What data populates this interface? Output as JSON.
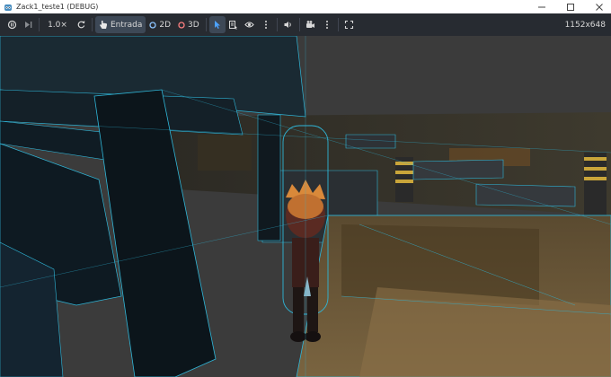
{
  "window": {
    "title": "Zack1_teste1 (DEBUG)",
    "resolution": "1152x648"
  },
  "toolbar": {
    "speed": "1.0×",
    "entrada_label": "Entrada",
    "label_2d": "2D",
    "label_3d": "3D"
  },
  "icons": {
    "app": "godot-icon",
    "minimize": "minimize-icon",
    "maximize": "maximize-icon",
    "close": "close-icon"
  },
  "colors": {
    "toolbar_bg": "#272b31",
    "accent": "#4da3ff",
    "wireframe": "#2fb6d8"
  }
}
